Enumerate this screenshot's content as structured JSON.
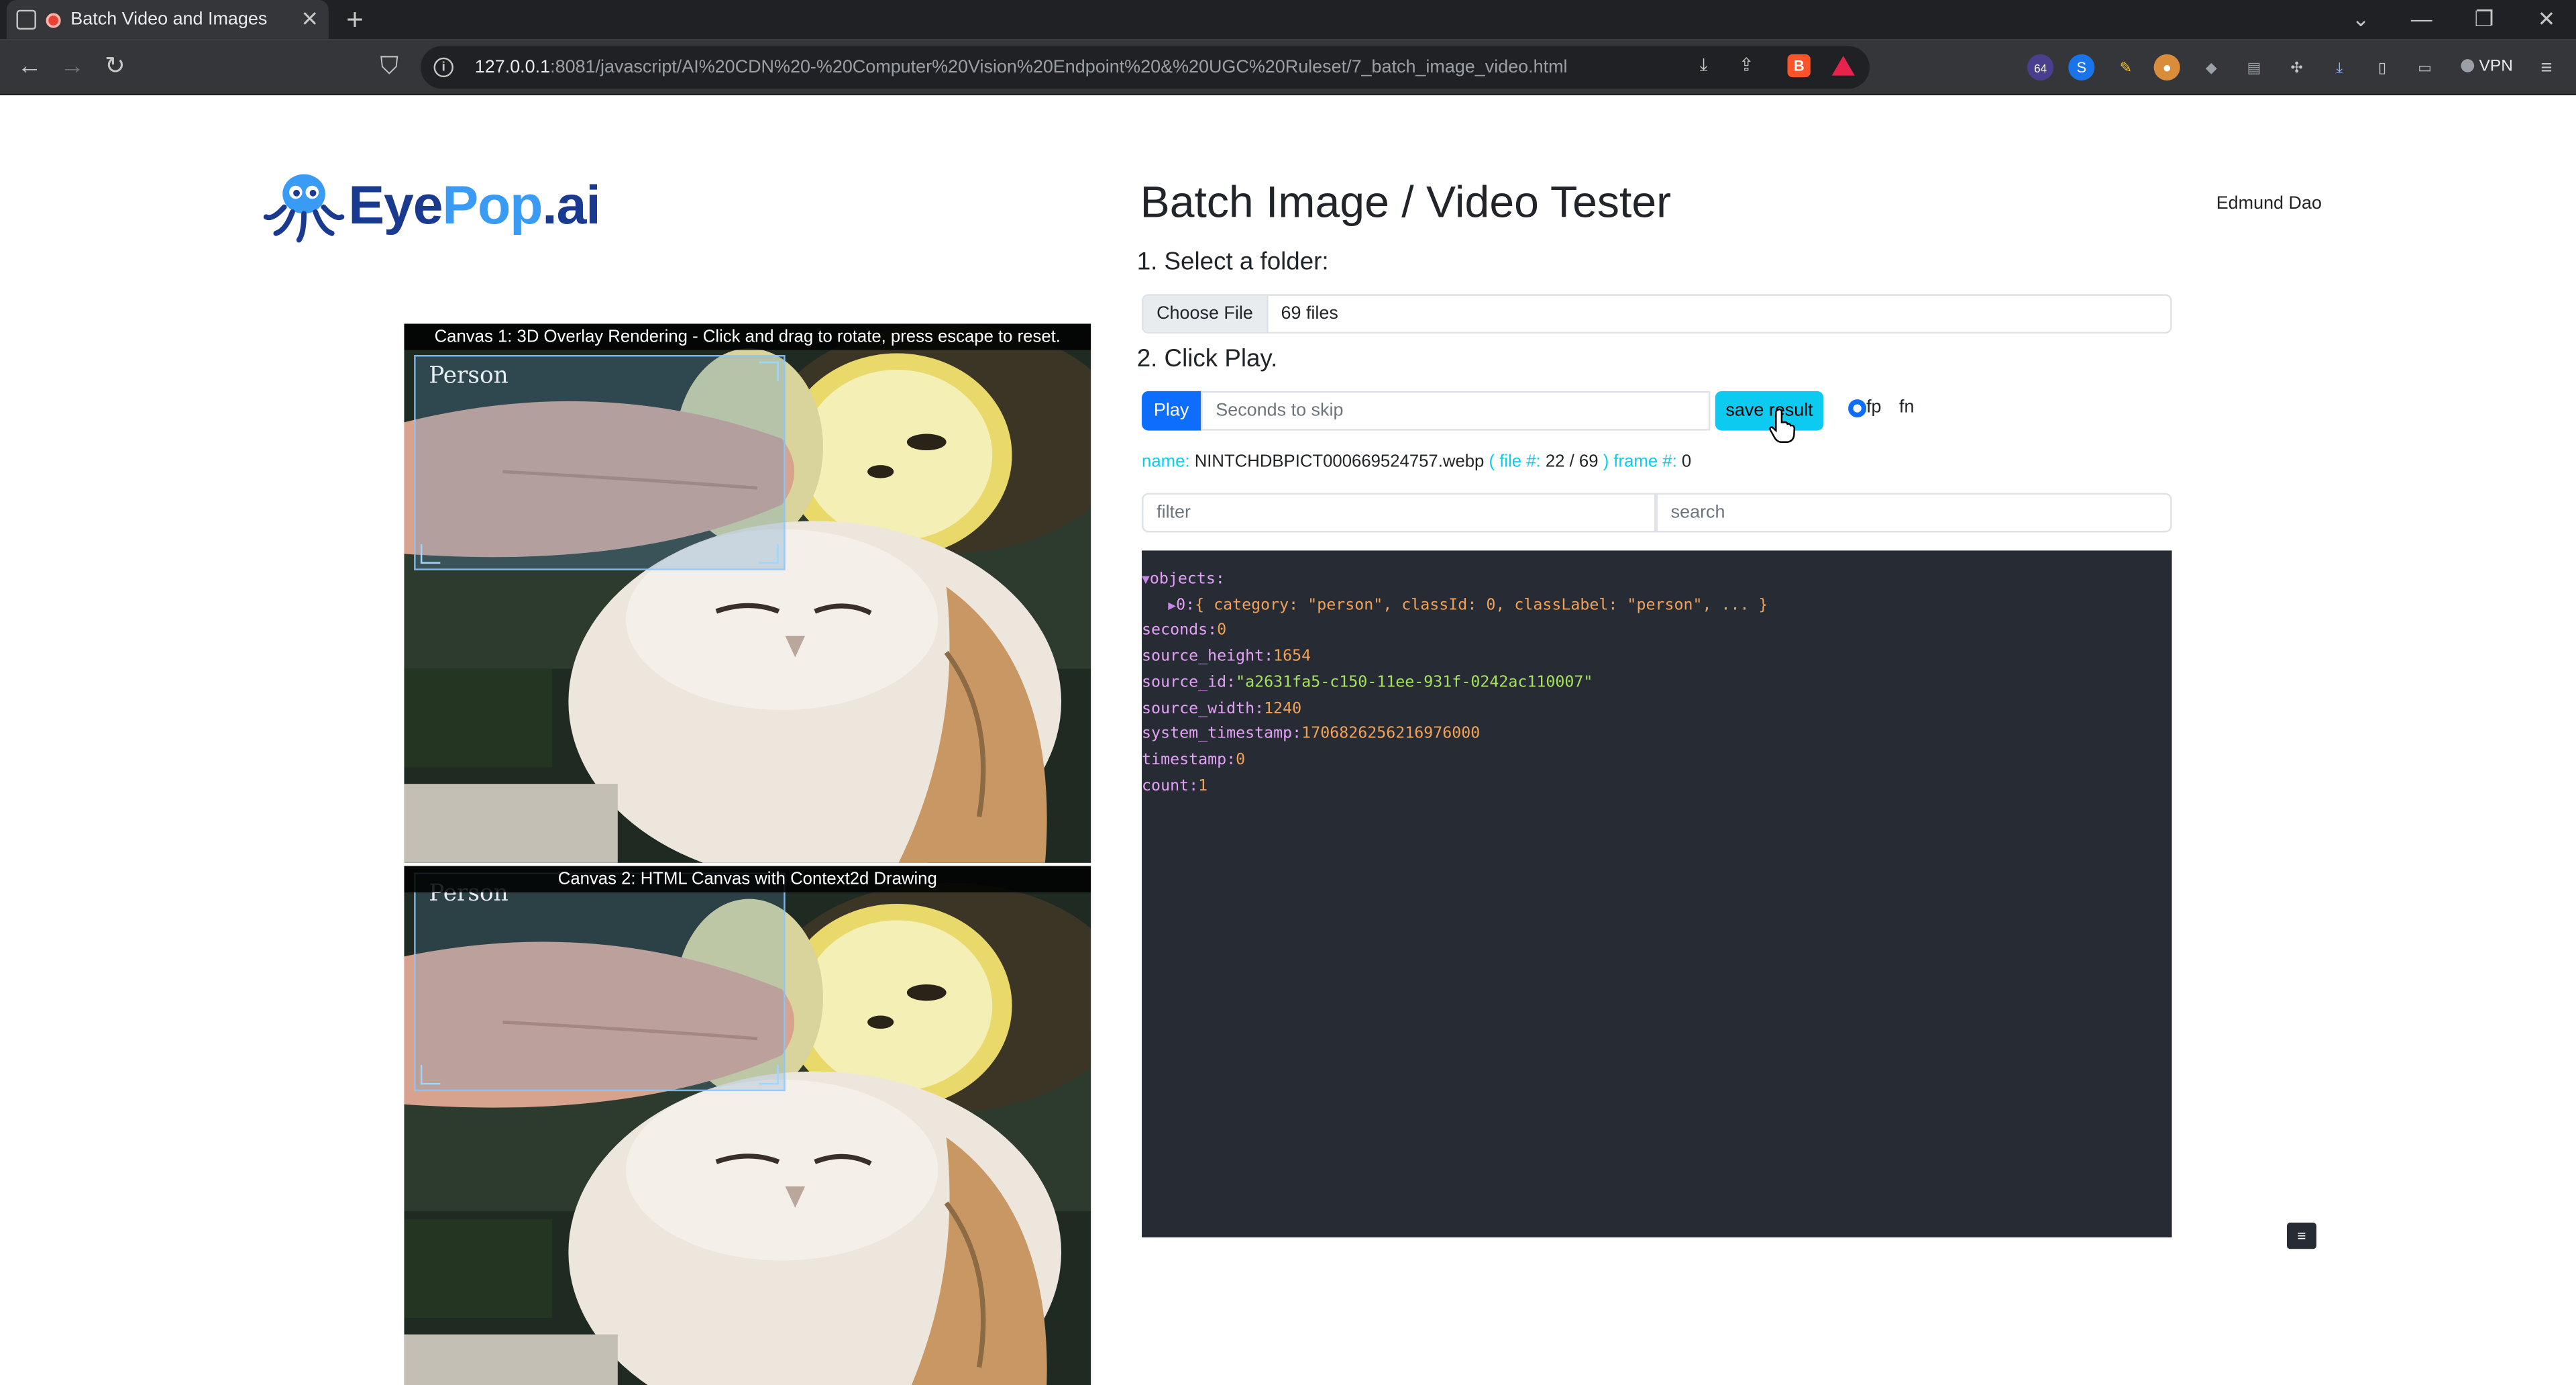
{
  "browser": {
    "tab_title": "Batch Video and Images",
    "url_host": "127.0.0.1",
    "url_rest": ":8081/javascript/AI%20CDN%20-%20Computer%20Vision%20Endpoint%20&%20UGC%20Ruleset/7_batch_image_video.html",
    "extension_badge": "64",
    "vpn_label": "VPN"
  },
  "header": {
    "logo_eye": "Eye",
    "logo_pop": "Pop",
    "logo_ai": ".ai",
    "title": "Batch Image / Video Tester",
    "user": "Edmund Dao"
  },
  "steps": {
    "step1": "1. Select a folder:",
    "step2": "2. Click Play."
  },
  "file_input": {
    "button": "Choose File",
    "value": "69 files"
  },
  "controls": {
    "play": "Play",
    "skip_placeholder": "Seconds to skip",
    "save": "save result",
    "radio_fp": "fp",
    "radio_fn": "fn"
  },
  "status": {
    "name_key": "name:",
    "name_value": "NINTCHDBPICT000669524757.webp",
    "file_key_open": "( file #:",
    "file_value": "22 / 69",
    "file_key_close": ")",
    "frame_key": "frame #:",
    "frame_value": "0"
  },
  "filters": {
    "filter_placeholder": "filter",
    "search_placeholder": "search"
  },
  "json_view": {
    "objects_key": "objects:",
    "object0_index": "0:",
    "object0_summary": "{ category: \"person\", classId: 0, classLabel: \"person\", ... }",
    "rows": [
      {
        "key": "seconds:",
        "value": "0",
        "type": "num"
      },
      {
        "key": "source_height:",
        "value": "1654",
        "type": "num"
      },
      {
        "key": "source_id:",
        "value": "\"a2631fa5-c150-11ee-931f-0242ac110007\"",
        "type": "str"
      },
      {
        "key": "source_width:",
        "value": "1240",
        "type": "num"
      },
      {
        "key": "system_timestamp:",
        "value": "1706826256216976000",
        "type": "num"
      },
      {
        "key": "timestamp:",
        "value": "0",
        "type": "num"
      },
      {
        "key": "count:",
        "value": "1",
        "type": "num"
      }
    ],
    "button": "≡"
  },
  "canvases": {
    "canvas1_caption": "Canvas 1: 3D Overlay Rendering - Click and drag to rotate, press escape to reset.",
    "canvas2_caption": "Canvas 2: HTML Canvas with Context2d Drawing",
    "detection_label": "Person"
  },
  "colors": {
    "primary": "#0d6efd",
    "info": "#0dcaf0",
    "json_bg": "#272c34"
  }
}
